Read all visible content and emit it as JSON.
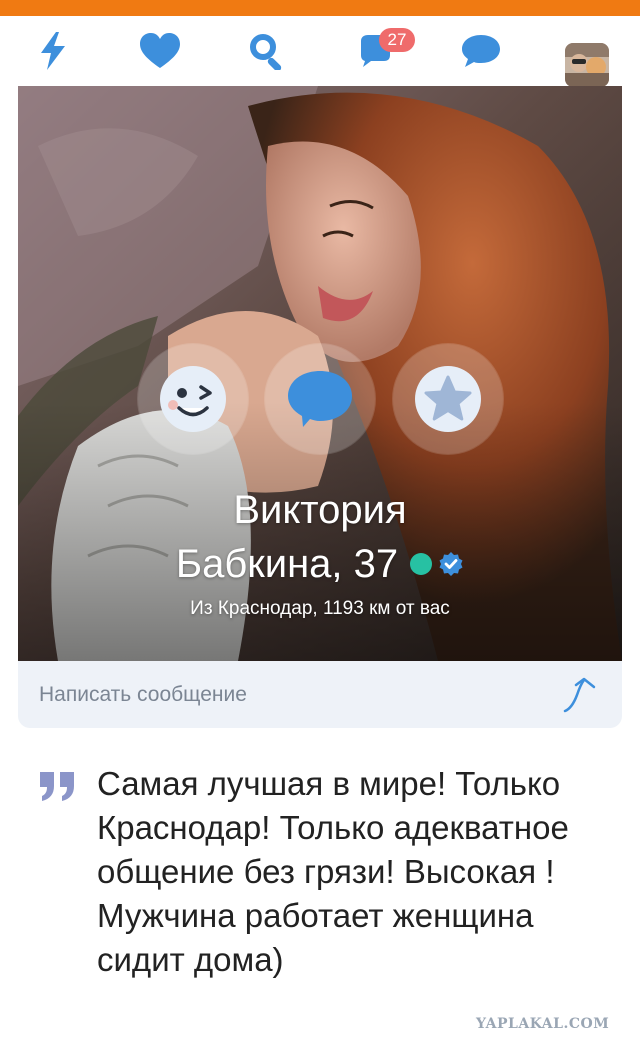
{
  "colors": {
    "topbar": "#f07a12",
    "accent": "#3d8fdc",
    "badge": "#ef6b6b",
    "online": "#27c1a3",
    "verified": "#3d8fdc",
    "msgbar_bg": "#eef2f8",
    "placeholder_text": "#7b8593",
    "quote_mark": "#8b95c9",
    "watermark": "#9aa6b4"
  },
  "nav": {
    "items": [
      {
        "icon": "lightning-icon"
      },
      {
        "icon": "heart-icon"
      },
      {
        "icon": "search-icon"
      },
      {
        "icon": "chat-bubble-icon",
        "badge": "27"
      },
      {
        "icon": "message-icon"
      },
      {
        "icon": "profile-avatar"
      }
    ]
  },
  "profile": {
    "name_line1": "Виктория",
    "name_line2": "Бабкина, 37",
    "online": true,
    "verified": true,
    "location": "Из Краснодар, 1193 км от вас",
    "actions": [
      {
        "icon": "wink-icon"
      },
      {
        "icon": "message-bubble-icon"
      },
      {
        "icon": "star-icon"
      }
    ]
  },
  "message": {
    "placeholder": "Написать сообщение",
    "send_icon": "send-arrow-icon"
  },
  "about": {
    "text": "Самая лучшая в мире! Только Краснодар! Только адекватное общение без грязи! Высокая ! Мужчина работает женщина сидит дома)"
  },
  "watermark": "YAPLAKAL.COM"
}
